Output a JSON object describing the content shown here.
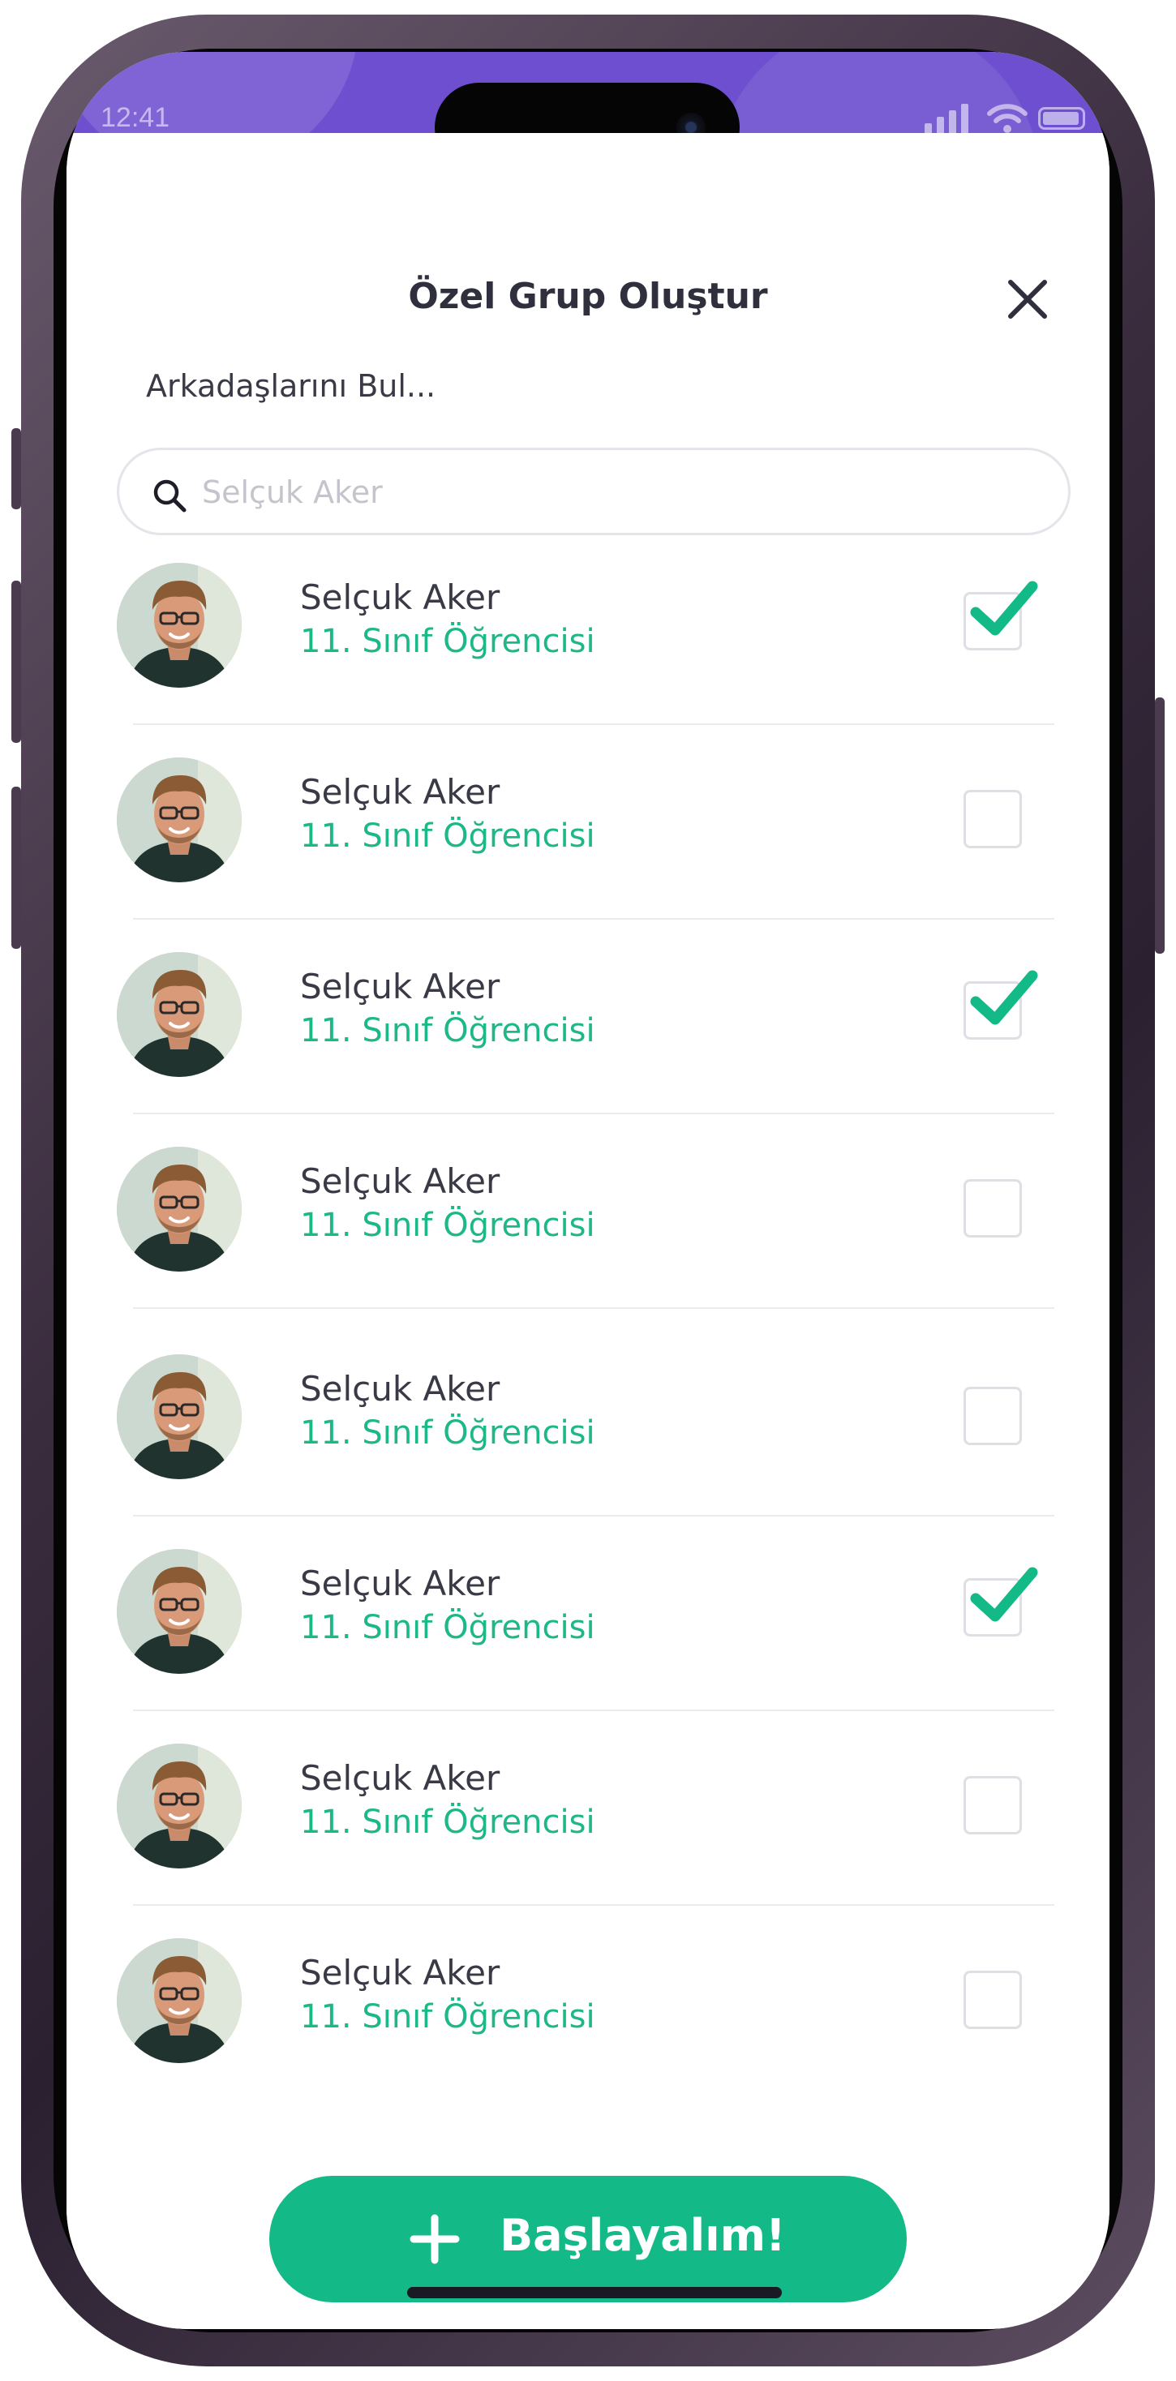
{
  "status_bar": {
    "time": "12:41"
  },
  "header": {
    "title": "Özel Grup Oluştur",
    "find_label": "Arkadaşlarını Bul..."
  },
  "search": {
    "value": "",
    "placeholder": "Selçuk Aker"
  },
  "contacts": [
    {
      "name": "Selçuk Aker",
      "role": "11. Sınıf Öğrencisi",
      "selected": true
    },
    {
      "name": "Selçuk Aker",
      "role": "11. Sınıf Öğrencisi",
      "selected": false
    },
    {
      "name": "Selçuk Aker",
      "role": "11. Sınıf Öğrencisi",
      "selected": true
    },
    {
      "name": "Selçuk Aker",
      "role": "11. Sınıf Öğrencisi",
      "selected": false
    },
    {
      "name": "Selçuk Aker",
      "role": "11. Sınıf Öğrencisi",
      "selected": false
    },
    {
      "name": "Selçuk Aker",
      "role": "11. Sınıf Öğrencisi",
      "selected": true
    },
    {
      "name": "Selçuk Aker",
      "role": "11. Sınıf Öğrencisi",
      "selected": false
    },
    {
      "name": "Selçuk Aker",
      "role": "11. Sınıf Öğrencisi",
      "selected": false
    }
  ],
  "action": {
    "label": "Başlayalım!",
    "icon": "plus-icon"
  },
  "colors": {
    "accent": "#13ba87",
    "role_text": "#1db887",
    "status_bar": "#6e4fcf",
    "title_text": "#2f2f3d"
  },
  "icons": {
    "close": "close-icon",
    "search": "search-icon",
    "check": "check-icon"
  }
}
